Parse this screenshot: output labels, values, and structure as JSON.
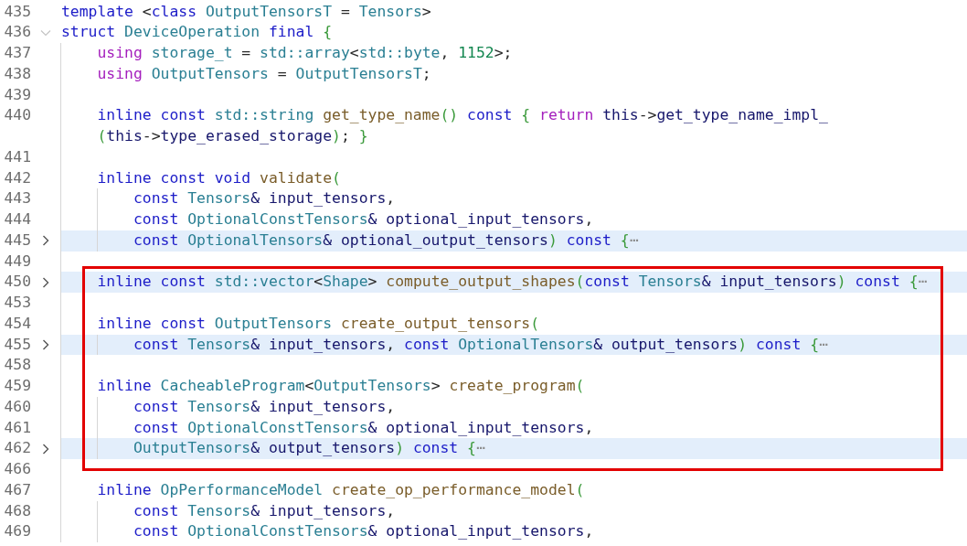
{
  "blocks": [
    {
      "kind": "plain",
      "lines": [
        {
          "number": "435",
          "highlighted": false,
          "segments": [
            {
              "kind": "keyword",
              "text": "template"
            },
            {
              "kind": "plain",
              "text": " <"
            },
            {
              "kind": "keyword",
              "text": "class "
            },
            {
              "kind": "type",
              "text": "OutputTensorsT"
            },
            {
              "kind": "plain",
              "text": " = "
            },
            {
              "kind": "type",
              "text": "Tensors"
            },
            {
              "kind": "plain",
              "text": ">"
            }
          ]
        },
        {
          "number": "436",
          "folded": false,
          "highlighted": false,
          "segments": [
            {
              "kind": "keyword",
              "text": "struct "
            },
            {
              "kind": "type",
              "text": "DeviceOperation "
            },
            {
              "kind": "keyword",
              "text": "final "
            },
            {
              "kind": "brace",
              "text": "{"
            }
          ]
        },
        {
          "number": "437",
          "highlighted": false,
          "segments": [
            {
              "kind": "control",
              "text": "    using "
            },
            {
              "kind": "type",
              "text": "storage_t"
            },
            {
              "kind": "plain",
              "text": " = "
            },
            {
              "kind": "type",
              "text": "std::array"
            },
            {
              "kind": "plain",
              "text": "<"
            },
            {
              "kind": "type",
              "text": "std::byte"
            },
            {
              "kind": "plain",
              "text": ", "
            },
            {
              "kind": "number",
              "text": "1152"
            },
            {
              "kind": "plain",
              "text": ">;"
            }
          ]
        },
        {
          "number": "438",
          "highlighted": false,
          "segments": [
            {
              "kind": "control",
              "text": "    using "
            },
            {
              "kind": "type",
              "text": "OutputTensors"
            },
            {
              "kind": "plain",
              "text": " = "
            },
            {
              "kind": "type",
              "text": "OutputTensorsT"
            },
            {
              "kind": "plain",
              "text": ";"
            }
          ]
        },
        {
          "number": "439",
          "highlighted": false
        },
        {
          "number": "440",
          "highlighted": false,
          "segments": [
            {
              "kind": "keyword",
              "text": "    inline const "
            },
            {
              "kind": "type",
              "text": "std::string "
            },
            {
              "kind": "function",
              "text": "get_type_name"
            },
            {
              "kind": "brace",
              "text": "() "
            },
            {
              "kind": "keyword",
              "text": "const "
            },
            {
              "kind": "brace",
              "text": "{ "
            },
            {
              "kind": "control",
              "text": "return "
            },
            {
              "kind": "variable",
              "text": "this"
            },
            {
              "kind": "plain",
              "text": "->"
            },
            {
              "kind": "variable",
              "text": "get_type_name_impl_"
            }
          ],
          "wrap": [
            {
              "kind": "brace",
              "text": "    ("
            },
            {
              "kind": "variable",
              "text": "this"
            },
            {
              "kind": "plain",
              "text": "->"
            },
            {
              "kind": "variable",
              "text": "type_erased_storage"
            },
            {
              "kind": "brace",
              "text": ")"
            },
            {
              "kind": "plain",
              "text": "; "
            },
            {
              "kind": "brace",
              "text": "}"
            }
          ]
        },
        {
          "number": "441",
          "highlighted": false
        },
        {
          "number": "442",
          "highlighted": false,
          "segments": [
            {
              "kind": "keyword",
              "text": "    inline const void "
            },
            {
              "kind": "function",
              "text": "validate"
            },
            {
              "kind": "brace",
              "text": "("
            }
          ]
        },
        {
          "number": "443",
          "highlighted": false,
          "segments": [
            {
              "kind": "keyword",
              "text": "        const "
            },
            {
              "kind": "type",
              "text": "Tensors"
            },
            {
              "kind": "variable",
              "text": "& input_tensors"
            },
            {
              "kind": "plain",
              "text": ","
            }
          ]
        },
        {
          "number": "444",
          "highlighted": false,
          "segments": [
            {
              "kind": "keyword",
              "text": "        const "
            },
            {
              "kind": "type",
              "text": "OptionalConstTensors"
            },
            {
              "kind": "variable",
              "text": "& optional_input_tensors"
            },
            {
              "kind": "plain",
              "text": ","
            }
          ]
        },
        {
          "number": "445",
          "folded": true,
          "highlighted": true,
          "segments": [
            {
              "kind": "keyword",
              "text": "        const "
            },
            {
              "kind": "type",
              "text": "OptionalTensors"
            },
            {
              "kind": "variable",
              "text": "& optional_output_tensors"
            },
            {
              "kind": "brace",
              "text": ") "
            },
            {
              "kind": "keyword",
              "text": "const "
            },
            {
              "kind": "brace",
              "text": "{"
            },
            {
              "kind": "ellipsis",
              "text": "⋯"
            }
          ]
        },
        {
          "number": "449",
          "highlighted": false
        }
      ]
    },
    {
      "kind": "annotated",
      "lines": [
        {
          "number": "450",
          "folded": true,
          "highlighted": true,
          "segments": [
            {
              "kind": "keyword",
              "text": "    inline const "
            },
            {
              "kind": "type",
              "text": "std::vector"
            },
            {
              "kind": "plain",
              "text": "<"
            },
            {
              "kind": "type",
              "text": "Shape"
            },
            {
              "kind": "plain",
              "text": "> "
            },
            {
              "kind": "function",
              "text": "compute_output_shapes"
            },
            {
              "kind": "brace",
              "text": "("
            },
            {
              "kind": "keyword",
              "text": "const "
            },
            {
              "kind": "type",
              "text": "Tensors"
            },
            {
              "kind": "variable",
              "text": "& input_tensors"
            },
            {
              "kind": "brace",
              "text": ") "
            },
            {
              "kind": "keyword",
              "text": "const "
            },
            {
              "kind": "brace",
              "text": "{"
            },
            {
              "kind": "ellipsis",
              "text": "⋯"
            }
          ]
        },
        {
          "number": "453",
          "highlighted": false
        },
        {
          "number": "454",
          "highlighted": false,
          "segments": [
            {
              "kind": "keyword",
              "text": "    inline const "
            },
            {
              "kind": "type",
              "text": "OutputTensors "
            },
            {
              "kind": "function",
              "text": "create_output_tensors"
            },
            {
              "kind": "brace",
              "text": "("
            }
          ]
        },
        {
          "number": "455",
          "folded": true,
          "highlighted": true,
          "segments": [
            {
              "kind": "keyword",
              "text": "        const "
            },
            {
              "kind": "type",
              "text": "Tensors"
            },
            {
              "kind": "variable",
              "text": "& input_tensors"
            },
            {
              "kind": "plain",
              "text": ", "
            },
            {
              "kind": "keyword",
              "text": "const "
            },
            {
              "kind": "type",
              "text": "OptionalTensors"
            },
            {
              "kind": "variable",
              "text": "& output_tensors"
            },
            {
              "kind": "brace",
              "text": ") "
            },
            {
              "kind": "keyword",
              "text": "const "
            },
            {
              "kind": "brace",
              "text": "{"
            },
            {
              "kind": "ellipsis",
              "text": "⋯"
            }
          ]
        },
        {
          "number": "458",
          "highlighted": false
        },
        {
          "number": "459",
          "highlighted": false,
          "segments": [
            {
              "kind": "keyword",
              "text": "    inline "
            },
            {
              "kind": "type",
              "text": "CacheableProgram"
            },
            {
              "kind": "plain",
              "text": "<"
            },
            {
              "kind": "type",
              "text": "OutputTensors"
            },
            {
              "kind": "plain",
              "text": "> "
            },
            {
              "kind": "function",
              "text": "create_program"
            },
            {
              "kind": "brace",
              "text": "("
            }
          ]
        },
        {
          "number": "460",
          "highlighted": false,
          "segments": [
            {
              "kind": "keyword",
              "text": "        const "
            },
            {
              "kind": "type",
              "text": "Tensors"
            },
            {
              "kind": "variable",
              "text": "& input_tensors"
            },
            {
              "kind": "plain",
              "text": ","
            }
          ]
        },
        {
          "number": "461",
          "highlighted": false,
          "segments": [
            {
              "kind": "keyword",
              "text": "        const "
            },
            {
              "kind": "type",
              "text": "OptionalConstTensors"
            },
            {
              "kind": "variable",
              "text": "& optional_input_tensors"
            },
            {
              "kind": "plain",
              "text": ","
            }
          ]
        },
        {
          "number": "462",
          "folded": true,
          "highlighted": true,
          "segments": [
            {
              "kind": "type",
              "text": "        OutputTensors"
            },
            {
              "kind": "variable",
              "text": "& output_tensors"
            },
            {
              "kind": "brace",
              "text": ") "
            },
            {
              "kind": "keyword",
              "text": "const "
            },
            {
              "kind": "brace",
              "text": "{"
            },
            {
              "kind": "ellipsis",
              "text": "⋯"
            }
          ]
        }
      ]
    },
    {
      "kind": "plain",
      "lines": [
        {
          "number": "466",
          "highlighted": false
        },
        {
          "number": "467",
          "highlighted": false,
          "segments": [
            {
              "kind": "keyword",
              "text": "    inline "
            },
            {
              "kind": "type",
              "text": "OpPerformanceModel "
            },
            {
              "kind": "function",
              "text": "create_op_performance_model"
            },
            {
              "kind": "brace",
              "text": "("
            }
          ]
        },
        {
          "number": "468",
          "highlighted": false,
          "segments": [
            {
              "kind": "keyword",
              "text": "        const "
            },
            {
              "kind": "type",
              "text": "Tensors"
            },
            {
              "kind": "variable",
              "text": "& input_tensors"
            },
            {
              "kind": "plain",
              "text": ","
            }
          ]
        },
        {
          "number": "469",
          "highlighted": false,
          "segments": [
            {
              "kind": "keyword",
              "text": "        const "
            },
            {
              "kind": "type",
              "text": "OptionalConstTensors"
            },
            {
              "kind": "variable",
              "text": "& optional_input_tensors"
            },
            {
              "kind": "plain",
              "text": ","
            }
          ]
        }
      ]
    }
  ]
}
